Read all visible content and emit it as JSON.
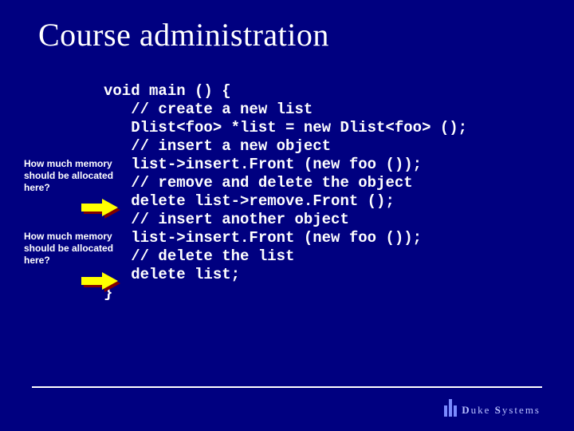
{
  "title": "Course administration",
  "code": "void main () {\n   // create a new list\n   Dlist<foo> *list = new Dlist<foo> ();\n   // insert a new object\n   list->insert.Front (new foo ());\n   // remove and delete the object\n   delete list->remove.Front ();\n   // insert another object\n   list->insert.Front (new foo ());\n   // delete the list\n   delete list;\n}",
  "notes": {
    "first": "How much memory should be allocated here?",
    "second": "How much memory should be allocated here?"
  },
  "logo": {
    "brand_bold": "D",
    "brand_rest": "uke",
    "brand_bold2": "S",
    "brand_rest2": "ystems"
  }
}
